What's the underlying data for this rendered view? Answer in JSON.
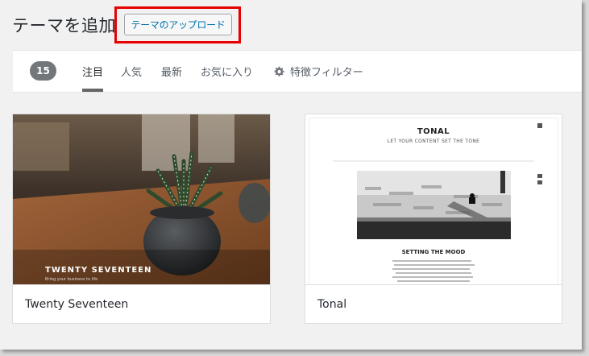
{
  "header": {
    "title": "テーマを追加",
    "upload_label": "テーマのアップロード"
  },
  "filter_bar": {
    "count": "15",
    "tabs": [
      {
        "label": "注目",
        "active": true
      },
      {
        "label": "人気",
        "active": false
      },
      {
        "label": "最新",
        "active": false
      },
      {
        "label": "お気に入り",
        "active": false
      }
    ],
    "feature_filter_label": "特徴フィルター"
  },
  "themes": [
    {
      "name": "Twenty Seventeen",
      "screenshot_title": "TWENTY SEVENTEEN",
      "screenshot_subtitle": "Bring your business to life"
    },
    {
      "name": "Tonal",
      "screenshot_title": "TONAL",
      "screenshot_tagline": "LET YOUR CONTENT SET THE TONE",
      "screenshot_heading": "SETTING THE MOOD"
    }
  ],
  "colors": {
    "highlight": "#e60000",
    "link": "#0073aa",
    "badge": "#72777c"
  }
}
